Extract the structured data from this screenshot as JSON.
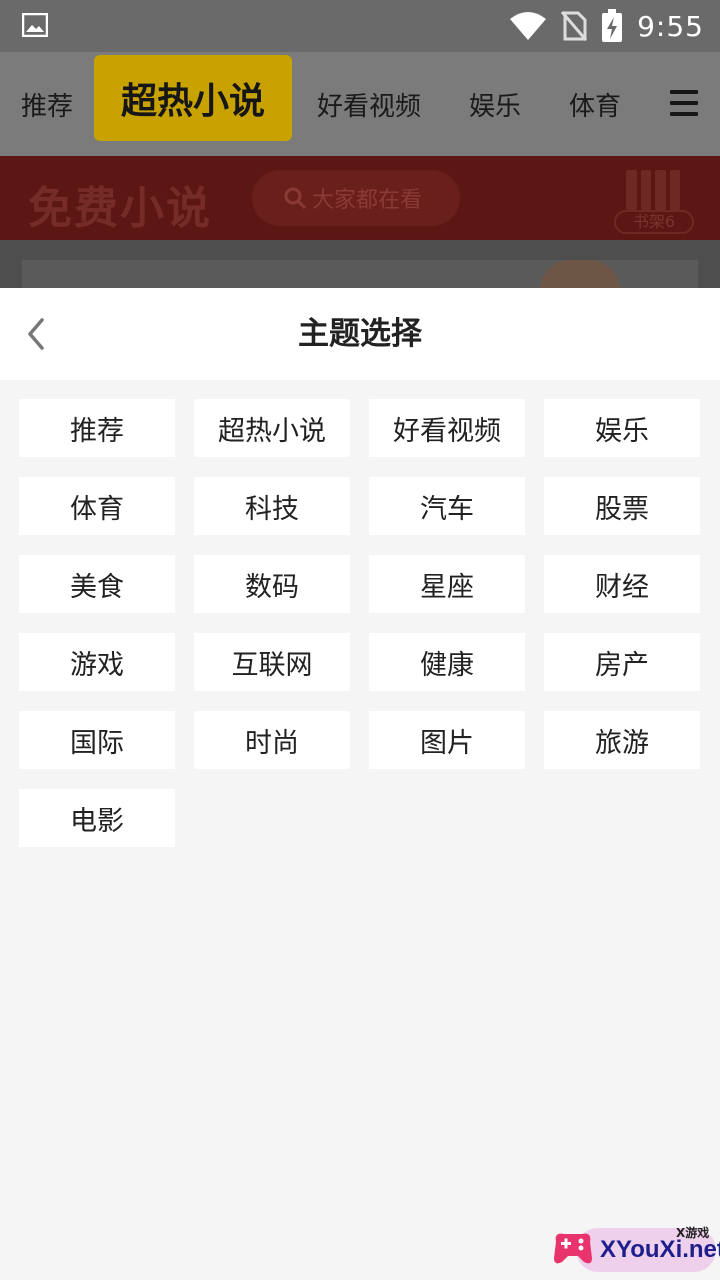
{
  "status_bar": {
    "time": "9:55",
    "icons": [
      "gallery-icon",
      "wifi-icon",
      "no-sim-icon",
      "battery-charging-icon"
    ]
  },
  "channel_tabs": {
    "items": [
      {
        "label": "推荐",
        "active": false
      },
      {
        "label": "超热小说",
        "active": true
      },
      {
        "label": "好看视频",
        "active": false
      },
      {
        "label": "娱乐",
        "active": false
      },
      {
        "label": "体育",
        "active": false
      }
    ],
    "menu_icon": "hamburger-menu-icon",
    "active_color": "#c8a200"
  },
  "banner": {
    "title": "免费小说",
    "search_placeholder": "大家都在看",
    "bookshelf_label": "书架6"
  },
  "topic_sheet": {
    "title": "主题选择",
    "back_icon": "chevron-left-icon",
    "topics": [
      "推荐",
      "超热小说",
      "好看视频",
      "娱乐",
      "体育",
      "科技",
      "汽车",
      "股票",
      "美食",
      "数码",
      "星座",
      "财经",
      "游戏",
      "互联网",
      "健康",
      "房产",
      "国际",
      "时尚",
      "图片",
      "旅游",
      "电影"
    ]
  },
  "watermark": {
    "small_text": "X游戏",
    "text": "XYouXi.net"
  }
}
